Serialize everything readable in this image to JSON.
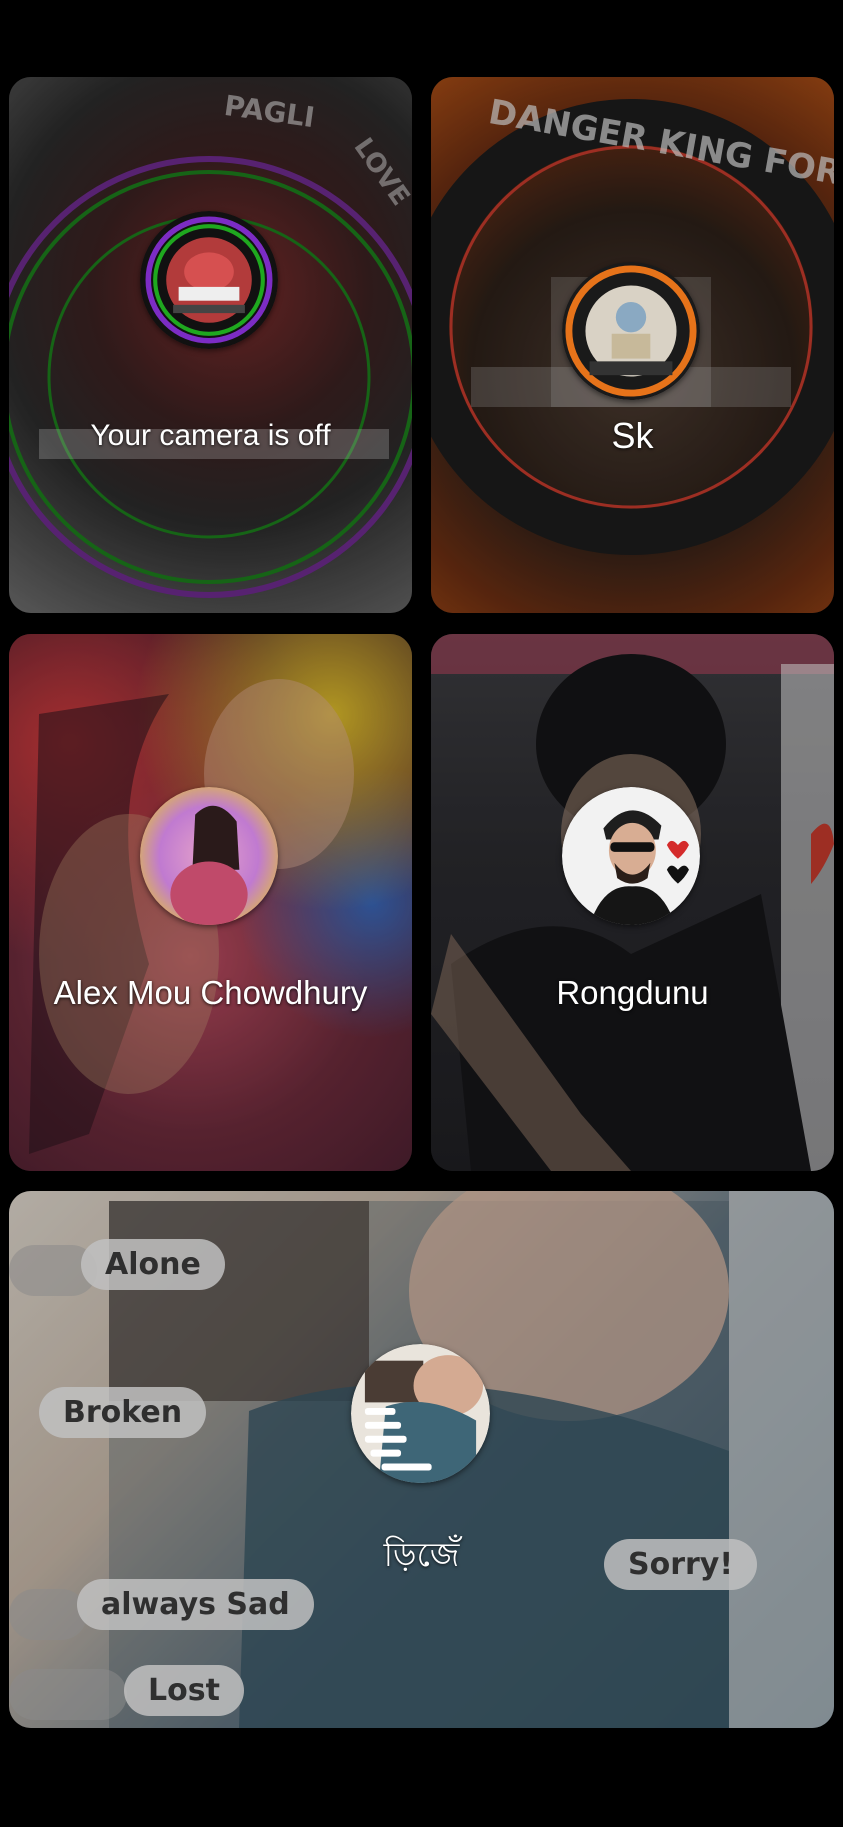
{
  "participants": [
    {
      "name": "Your camera is off",
      "avatar_icon": "user-avatar-pagli-love",
      "background_texts": [
        "PAGLI",
        "LOVE"
      ]
    },
    {
      "name": "Sk",
      "avatar_icon": "user-avatar-danger-king-force",
      "background_texts": [
        "DANGER KING FORCE"
      ]
    },
    {
      "name": "Alex Mou Chowdhury",
      "avatar_icon": "user-avatar-alex",
      "background_texts": []
    },
    {
      "name": "Rongdunu",
      "avatar_icon": "user-avatar-rongdunu",
      "background_texts": []
    },
    {
      "name": "ড়িজেঁ",
      "avatar_icon": "user-avatar-sad-collage",
      "background_texts": [
        "Alone",
        "Broken",
        "always Sad",
        "Lost",
        "Sorry!"
      ]
    }
  ],
  "colors": {
    "background": "#000000",
    "label": "#ffffff"
  }
}
